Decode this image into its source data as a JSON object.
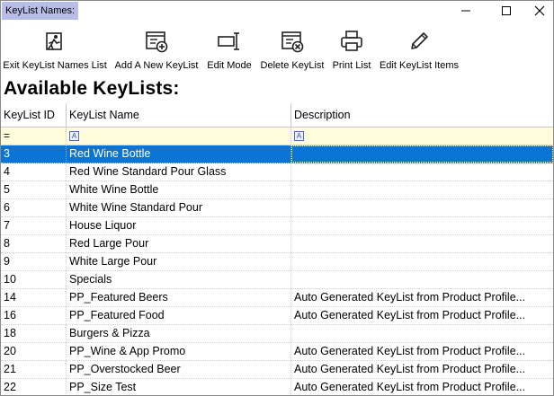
{
  "window": {
    "title": "KeyList Names:"
  },
  "toolbar": {
    "items": [
      {
        "label": "Exit KeyList Names List",
        "icon": "exit-icon"
      },
      {
        "label": "Add A New KeyList",
        "icon": "add-list-icon"
      },
      {
        "label": "Edit Mode",
        "icon": "edit-mode-icon"
      },
      {
        "label": "Delete KeyList",
        "icon": "delete-list-icon"
      },
      {
        "label": "Print List",
        "icon": "printer-icon"
      },
      {
        "label": "Edit KeyList Items",
        "icon": "pencil-icon"
      }
    ]
  },
  "heading": "Available KeyLists:",
  "grid": {
    "columns": [
      "KeyList ID",
      "KeyList Name",
      "Description"
    ],
    "filter": {
      "id_operator": "=",
      "text_filter_glyph": "A"
    },
    "selected_index": 0,
    "selection_color": "#0a74d6",
    "rows": [
      {
        "id": "3",
        "name": "Red Wine Bottle",
        "description": ""
      },
      {
        "id": "4",
        "name": "Red Wine Standard Pour Glass",
        "description": ""
      },
      {
        "id": "5",
        "name": "White Wine Bottle",
        "description": ""
      },
      {
        "id": "6",
        "name": "White Wine Standard Pour",
        "description": ""
      },
      {
        "id": "7",
        "name": "House Liquor",
        "description": ""
      },
      {
        "id": "8",
        "name": "Red Large Pour",
        "description": ""
      },
      {
        "id": "9",
        "name": "White Large Pour",
        "description": ""
      },
      {
        "id": "10",
        "name": "Specials",
        "description": ""
      },
      {
        "id": "14",
        "name": "PP_Featured Beers",
        "description": "Auto Generated KeyList from Product Profile..."
      },
      {
        "id": "16",
        "name": "PP_Featured Food",
        "description": "Auto Generated KeyList from Product Profile..."
      },
      {
        "id": "18",
        "name": "Burgers & Pizza",
        "description": ""
      },
      {
        "id": "20",
        "name": "PP_Wine & App Promo",
        "description": "Auto Generated KeyList from Product Profile..."
      },
      {
        "id": "21",
        "name": "PP_Overstocked Beer",
        "description": "Auto Generated KeyList from Product Profile..."
      },
      {
        "id": "22",
        "name": "PP_Size Test",
        "description": "Auto Generated KeyList from Product Profile..."
      }
    ]
  }
}
